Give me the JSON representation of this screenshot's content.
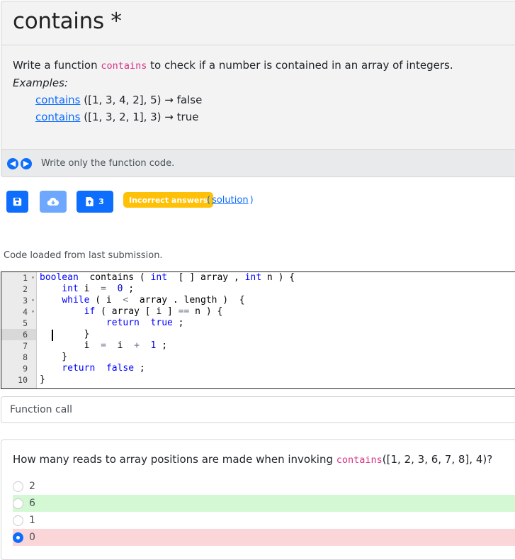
{
  "problem": {
    "title": "contains *",
    "statement_before": "Write a function ",
    "statement_code": "contains",
    "statement_after": " to check if a number is contained in an array of integers.",
    "examples_label": "Examples:",
    "examples": [
      {
        "fn": "contains",
        "args": " ([1, 3, 4, 2], 5) → false"
      },
      {
        "fn": "contains",
        "args": " ([1, 3, 2, 1], 3) → true"
      }
    ],
    "footer_note": "Write only the function code."
  },
  "toolbar": {
    "submissions_count": "3",
    "status_badge": "Incorrect answers",
    "solution_open": "(",
    "solution_link": "solution",
    "solution_close": ")"
  },
  "loaded_message": "Code loaded from last submission.",
  "editor": {
    "active_line": 6,
    "lines": [
      {
        "n": "1",
        "fold": true,
        "tokens": [
          [
            "kw",
            "boolean"
          ],
          [
            "",
            "  contains ( "
          ],
          [
            "kw",
            "int"
          ],
          [
            "",
            "  [ ] array , "
          ],
          [
            "kw",
            "int"
          ],
          [
            "",
            " n ) {"
          ]
        ]
      },
      {
        "n": "2",
        "fold": false,
        "tokens": [
          [
            "",
            "    "
          ],
          [
            "kw",
            "int"
          ],
          [
            "",
            " i "
          ],
          [
            "op",
            " = "
          ],
          [
            "num-lit",
            " 0"
          ],
          [
            "",
            " ;"
          ]
        ]
      },
      {
        "n": "3",
        "fold": true,
        "tokens": [
          [
            "",
            "    "
          ],
          [
            "kw",
            "while"
          ],
          [
            "",
            " ( i "
          ],
          [
            "op",
            " < "
          ],
          [
            "",
            " array . length )  {"
          ]
        ]
      },
      {
        "n": "4",
        "fold": true,
        "tokens": [
          [
            "",
            "        "
          ],
          [
            "kw",
            "if"
          ],
          [
            "",
            " ( array [ i ] "
          ],
          [
            "op",
            "=="
          ],
          [
            "",
            " n ) {"
          ]
        ]
      },
      {
        "n": "5",
        "fold": false,
        "tokens": [
          [
            "",
            "            "
          ],
          [
            "kw",
            "return"
          ],
          [
            "",
            "  "
          ],
          [
            "kw",
            "true"
          ],
          [
            "",
            " ;"
          ]
        ]
      },
      {
        "n": "6",
        "fold": false,
        "tokens": [
          [
            "",
            "        }"
          ]
        ]
      },
      {
        "n": "7",
        "fold": false,
        "tokens": [
          [
            "",
            "        i "
          ],
          [
            "op",
            " = "
          ],
          [
            "",
            " i "
          ],
          [
            "op",
            " + "
          ],
          [
            "num-lit",
            " 1"
          ],
          [
            "",
            " ;"
          ]
        ]
      },
      {
        "n": "8",
        "fold": false,
        "tokens": [
          [
            "",
            "    }"
          ]
        ]
      },
      {
        "n": "9",
        "fold": false,
        "tokens": [
          [
            "",
            "    "
          ],
          [
            "kw",
            "return"
          ],
          [
            "",
            "  "
          ],
          [
            "kw",
            "false"
          ],
          [
            "",
            " ;"
          ]
        ]
      },
      {
        "n": "10",
        "fold": false,
        "tokens": [
          [
            "",
            "}"
          ]
        ]
      }
    ]
  },
  "function_call_label": "Function call",
  "question": {
    "text_before": "How many reads to array positions are made when invoking ",
    "text_code": "contains",
    "text_after": "([1, 2, 3, 6, 7, 8], 4)?",
    "options": [
      {
        "label": "2",
        "state": "",
        "checked": false
      },
      {
        "label": "6",
        "state": "correct",
        "checked": false
      },
      {
        "label": "1",
        "state": "",
        "checked": false
      },
      {
        "label": "0",
        "state": "wrong",
        "checked": true
      }
    ]
  },
  "colors": {
    "primary": "#0d6efd",
    "warning": "#ffc107",
    "correct_bg": "#d4f8d4",
    "wrong_bg": "#fbd6d8"
  }
}
